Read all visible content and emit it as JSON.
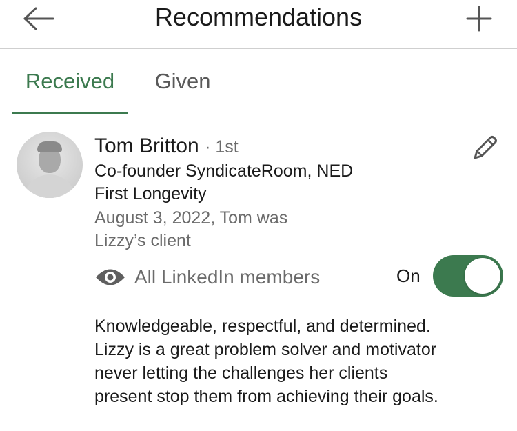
{
  "header": {
    "title": "Recommendations",
    "back_icon": "arrow-left-icon",
    "add_icon": "plus-icon"
  },
  "tabs": [
    {
      "label": "Received",
      "active": true
    },
    {
      "label": "Given",
      "active": false
    }
  ],
  "recommendation": {
    "name": "Tom Britton",
    "degree": "· 1st",
    "headline_line1": "Co-founder SyndicateRoom, NED",
    "headline_line2": "First Longevity",
    "meta_line1": "August 3, 2022, Tom was",
    "meta_line2": "Lizzy’s client",
    "edit_icon": "pencil-icon",
    "visibility": {
      "icon": "eye-icon",
      "label": "All LinkedIn members",
      "state_label": "On",
      "enabled": true
    },
    "text_line1": "Knowledgeable, respectful, and determined.",
    "text_line2": "Lizzy is a great problem solver and motivator",
    "text_line3": "never letting the challenges her clients",
    "text_line4": "present stop them from achieving their goals."
  },
  "colors": {
    "accent": "#3c7a4f",
    "secondary_text": "#6b6b6b",
    "divider": "#d8d8d8"
  }
}
